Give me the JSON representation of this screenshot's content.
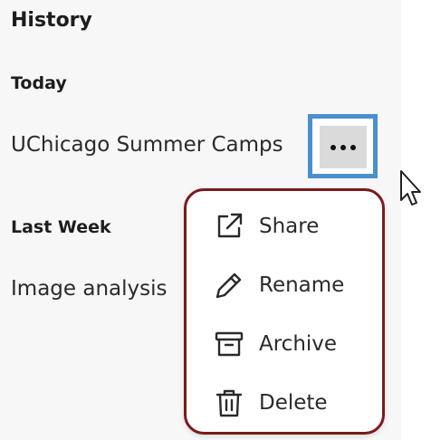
{
  "history": {
    "title": "History",
    "groups": [
      {
        "label": "Today",
        "items": [
          "UChicago Summer Camps"
        ]
      },
      {
        "label": "Last Week",
        "items": [
          "Image analysis"
        ]
      }
    ]
  },
  "more_button": {
    "icon": "more-horizontal-icon"
  },
  "context_menu": {
    "items": [
      {
        "label": "Share",
        "icon": "share-icon"
      },
      {
        "label": "Rename",
        "icon": "pencil-icon"
      },
      {
        "label": "Archive",
        "icon": "archive-icon"
      },
      {
        "label": "Delete",
        "icon": "trash-icon"
      }
    ]
  },
  "colors": {
    "focus_ring": "#4a8fd0",
    "menu_border": "#7a1a1c",
    "panel_bg": "#f7f7f7",
    "more_button_bg": "#dadada"
  }
}
